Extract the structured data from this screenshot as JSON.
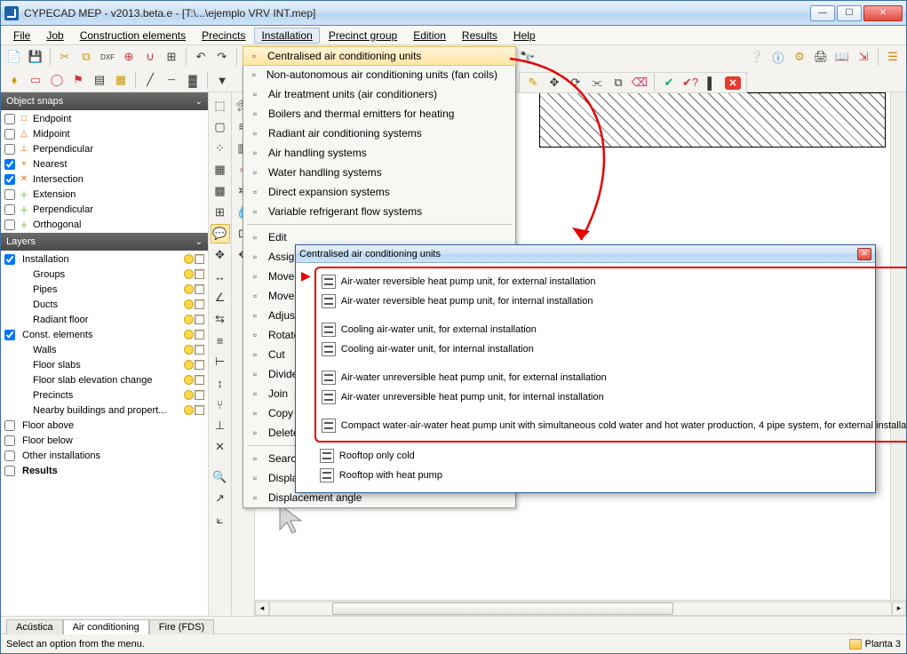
{
  "window": {
    "title": "CYPECAD MEP - v2013.beta.e - [T:\\...\\ejemplo VRV INT.mep]"
  },
  "menu": {
    "file": "File",
    "job": "Job",
    "construction": "Construction elements",
    "precincts": "Precincts",
    "installation": "Installation",
    "precinct_group": "Precinct group",
    "edition": "Edition",
    "results": "Results",
    "help": "Help"
  },
  "snaps": {
    "title": "Object snaps",
    "items": [
      {
        "checked": false,
        "icon": "□",
        "cls": "snap-orange",
        "label": "Endpoint"
      },
      {
        "checked": false,
        "icon": "△",
        "cls": "snap-orange",
        "label": "Midpoint"
      },
      {
        "checked": false,
        "icon": "⊥",
        "cls": "snap-orange",
        "label": "Perpendicular"
      },
      {
        "checked": true,
        "icon": "⌖",
        "cls": "snap-orange",
        "label": "Nearest"
      },
      {
        "checked": true,
        "icon": "✕",
        "cls": "snap-orange",
        "label": "Intersection"
      },
      {
        "checked": false,
        "icon": "＋",
        "cls": "snap-green",
        "label": "Extension"
      },
      {
        "checked": false,
        "icon": "＋",
        "cls": "snap-green",
        "label": "Perpendicular"
      },
      {
        "checked": false,
        "icon": "＋",
        "cls": "snap-green",
        "label": "Orthogonal"
      }
    ]
  },
  "layers": {
    "title": "Layers",
    "items": [
      {
        "checked": true,
        "indent": 0,
        "label": "Installation",
        "icons": 2,
        "bold": false
      },
      {
        "checked": null,
        "indent": 1,
        "label": "Groups",
        "icons": 2
      },
      {
        "checked": null,
        "indent": 1,
        "label": "Pipes",
        "icons": 2
      },
      {
        "checked": null,
        "indent": 1,
        "label": "Ducts",
        "icons": 2
      },
      {
        "checked": null,
        "indent": 1,
        "label": "Radiant floor",
        "icons": 2
      },
      {
        "checked": true,
        "indent": 0,
        "label": "Const. elements",
        "icons": 2
      },
      {
        "checked": null,
        "indent": 1,
        "label": "Walls",
        "icons": 2
      },
      {
        "checked": null,
        "indent": 1,
        "label": "Floor slabs",
        "icons": 2
      },
      {
        "checked": null,
        "indent": 1,
        "label": "Floor slab elevation change",
        "icons": 2
      },
      {
        "checked": null,
        "indent": 1,
        "label": "Precincts",
        "icons": 2
      },
      {
        "checked": null,
        "indent": 1,
        "label": "Nearby buildings and propert...",
        "icons": 2
      },
      {
        "checked": false,
        "indent": 0,
        "label": "Floor above",
        "icons": 0
      },
      {
        "checked": false,
        "indent": 0,
        "label": "Floor below",
        "icons": 0
      },
      {
        "checked": false,
        "indent": 0,
        "label": "Other installations",
        "icons": 0
      },
      {
        "checked": false,
        "indent": 0,
        "label": "Results",
        "icons": 0,
        "bold": true
      }
    ]
  },
  "installation_menu": {
    "items": [
      {
        "label": "Centralised air conditioning units",
        "hl": true
      },
      {
        "label": "Non-autonomous air conditioning units (fan coils)"
      },
      {
        "label": "Air treatment units (air conditioners)"
      },
      {
        "label": "Boilers and thermal emitters for heating"
      },
      {
        "label": "Radiant air conditioning systems"
      },
      {
        "label": "Air handling systems"
      },
      {
        "label": "Water handling systems"
      },
      {
        "label": "Direct expansion systems"
      },
      {
        "label": "Variable refrigerant flow systems"
      },
      {
        "sep": true
      },
      {
        "label": "Edit"
      },
      {
        "label": "Assign"
      },
      {
        "label": "Move"
      },
      {
        "label": "Move vertex"
      },
      {
        "label": "Adjust"
      },
      {
        "label": "Rotate"
      },
      {
        "label": "Cut"
      },
      {
        "label": "Divide"
      },
      {
        "label": "Join"
      },
      {
        "label": "Copy"
      },
      {
        "label": "Delete"
      },
      {
        "sep": true
      },
      {
        "label": "Search"
      },
      {
        "label": "Displace"
      },
      {
        "label": "Displacement angle"
      }
    ]
  },
  "subwindow": {
    "title": "Centralised air conditioning units",
    "group": [
      "Air-water reversible heat pump unit, for external installation",
      "Air-water reversible heat pump unit, for internal installation",
      "",
      "Cooling air-water unit, for external installation",
      "Cooling air-water unit, for internal installation",
      "",
      "Air-water unreversible heat pump unit, for external installation",
      "Air-water unreversible heat pump unit, for internal installation",
      "",
      "Compact water-air-water heat pump unit with simultaneous cold water and hot water production, 4 pipe system, for external installation"
    ],
    "outer": [
      "Rooftop only cold",
      "Rooftop with heat pump"
    ]
  },
  "tabs": {
    "t1": "Acústica",
    "t2": "Air conditioning",
    "t3": "Fire (FDS)"
  },
  "status": {
    "left": "Select an option from the menu.",
    "right": "Planta 3"
  }
}
